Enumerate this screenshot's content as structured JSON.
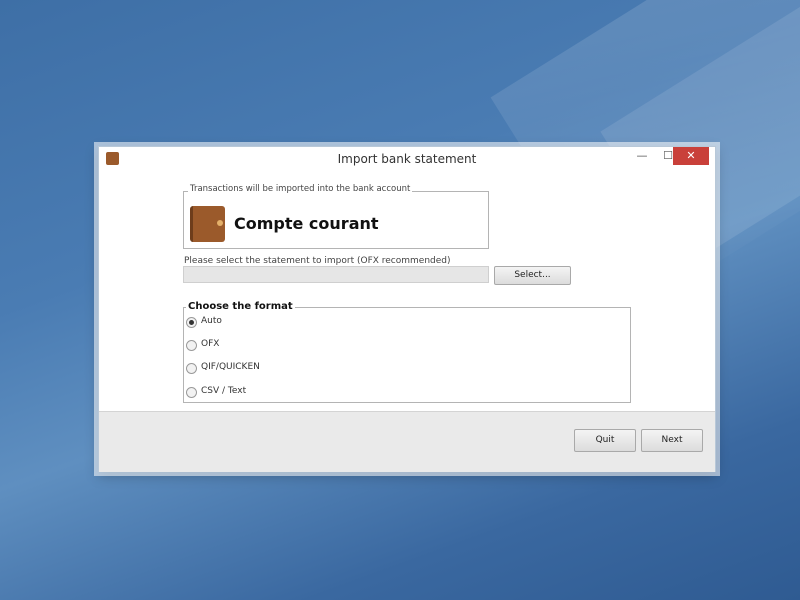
{
  "window": {
    "title": "Import bank statement",
    "minimize_glyph": "—",
    "maximize_glyph": "☐",
    "close_glyph": "✕"
  },
  "account": {
    "legend": "Transactions will be imported into the bank account",
    "name": "Compte courant",
    "icon": "wallet-icon"
  },
  "statement": {
    "label": "Please select the statement to import (OFX recommended)",
    "file_value": "",
    "select_button": "Select..."
  },
  "format": {
    "legend": "Choose the format",
    "selected": "Auto",
    "options": [
      {
        "label": "Auto",
        "checked": true
      },
      {
        "label": "OFX",
        "checked": false
      },
      {
        "label": "QIF/QUICKEN",
        "checked": false
      },
      {
        "label": "CSV / Text",
        "checked": false
      }
    ]
  },
  "footer": {
    "quit": "Quit",
    "next": "Next"
  },
  "colors": {
    "close_button": "#c9403a",
    "wallet": "#9b5a2b",
    "desktop": "#3e6fa6"
  }
}
